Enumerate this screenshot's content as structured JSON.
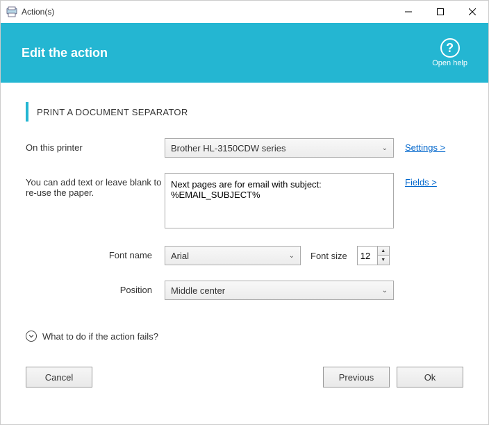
{
  "window": {
    "title": "Action(s)"
  },
  "header": {
    "title": "Edit the action",
    "help_label": "Open help"
  },
  "section": {
    "title": "PRINT A DOCUMENT SEPARATOR"
  },
  "form": {
    "printer_label": "On this printer",
    "printer_value": "Brother HL-3150CDW series",
    "settings_link": "Settings >",
    "text_label": "You can add text or leave blank to re-use the paper.",
    "text_value": "Next pages are for email with subject:\n%EMAIL_SUBJECT%",
    "fields_link": "Fields >",
    "font_name_label": "Font name",
    "font_name_value": "Arial",
    "font_size_label": "Font size",
    "font_size_value": "12",
    "position_label": "Position",
    "position_value": "Middle center"
  },
  "expander": {
    "label": "What to do if the action fails?"
  },
  "buttons": {
    "cancel": "Cancel",
    "previous": "Previous",
    "ok": "Ok"
  }
}
